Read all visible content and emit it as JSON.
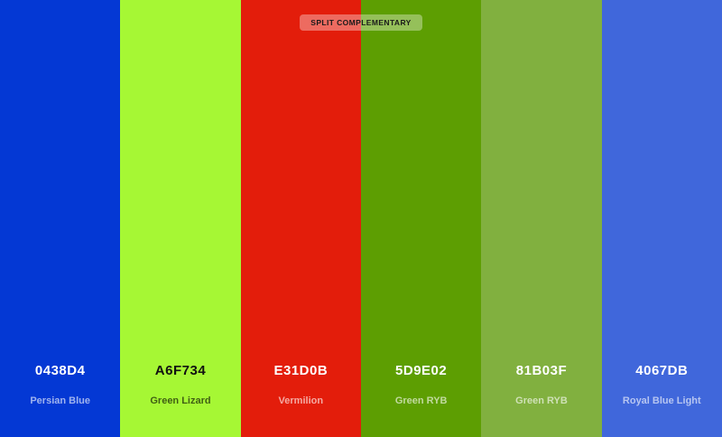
{
  "palette": {
    "scheme_label": "SPLIT COMPLEMENTARY",
    "colors": [
      {
        "hex": "0438D4",
        "name": "Persian Blue",
        "color": "#0438D4",
        "text_tone": "light"
      },
      {
        "hex": "A6F734",
        "name": "Green Lizard",
        "color": "#A6F734",
        "text_tone": "dark"
      },
      {
        "hex": "E31D0B",
        "name": "Vermilion",
        "color": "#E31D0B",
        "text_tone": "light"
      },
      {
        "hex": "5D9E02",
        "name": "Green RYB",
        "color": "#5D9E02",
        "text_tone": "light"
      },
      {
        "hex": "81B03F",
        "name": "Green RYB",
        "color": "#81B03F",
        "text_tone": "light"
      },
      {
        "hex": "4067DB",
        "name": "Royal Blue Light",
        "color": "#4067DB",
        "text_tone": "light"
      }
    ]
  }
}
